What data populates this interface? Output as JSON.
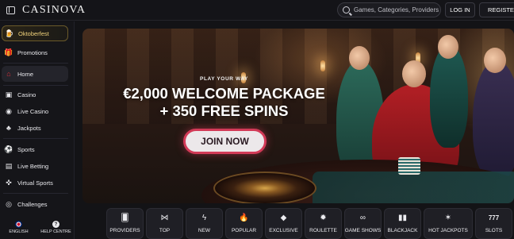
{
  "header": {
    "logo": "CASINOVA",
    "search_placeholder": "Games, Categories, Providers",
    "login_label": "LOG IN",
    "register_label": "REGISTER"
  },
  "sidebar": {
    "items": [
      {
        "label": "Oktoberfest",
        "icon": "beer-mug-icon"
      },
      {
        "label": "Promotions",
        "icon": "gift-icon"
      },
      {
        "label": "Home",
        "icon": "home-icon"
      },
      {
        "label": "Casino",
        "icon": "slot-icon"
      },
      {
        "label": "Live Casino",
        "icon": "chat-icon"
      },
      {
        "label": "Jackpots",
        "icon": "clover-icon"
      },
      {
        "label": "Sports",
        "icon": "soccer-ball-icon"
      },
      {
        "label": "Live Betting",
        "icon": "scoreboard-icon"
      },
      {
        "label": "Virtual Sports",
        "icon": "controller-icon"
      },
      {
        "label": "Challenges",
        "icon": "target-icon"
      }
    ],
    "footer": {
      "language_label": "ENGLISH",
      "help_label": "HELP CENTRE"
    }
  },
  "hero": {
    "kicker": "PLAY YOUR WAY",
    "title_line1": "€2,000 WELCOME PACKAGE",
    "title_line2": "+ 350 FREE SPINS",
    "cta_label": "JOIN NOW"
  },
  "categories": [
    {
      "label": "PROVIDERS",
      "icon": "card-icon",
      "glyph": "🂠"
    },
    {
      "label": "TOP",
      "icon": "bowtie-icon",
      "glyph": "⋈"
    },
    {
      "label": "NEW",
      "icon": "lightning-icon",
      "glyph": "ϟ"
    },
    {
      "label": "POPULAR",
      "icon": "flame-icon",
      "glyph": "🔥"
    },
    {
      "label": "EXCLUSIVE",
      "icon": "diamond-icon",
      "glyph": "◆"
    },
    {
      "label": "ROULETTE",
      "icon": "roulette-icon",
      "glyph": "✹"
    },
    {
      "label": "GAME SHOWS",
      "icon": "mask-icon",
      "glyph": "∞"
    },
    {
      "label": "BLACKJACK",
      "icon": "cards-icon",
      "glyph": "▮▮"
    },
    {
      "label": "HOT JACKPOTS",
      "icon": "jackpot-icon",
      "glyph": "✶"
    },
    {
      "label": "SLOTS",
      "icon": "slots-777-icon",
      "glyph": "777"
    }
  ],
  "colors": {
    "accent": "#d23a57",
    "featured_gold": "#f1d37c",
    "background": "#131316"
  }
}
